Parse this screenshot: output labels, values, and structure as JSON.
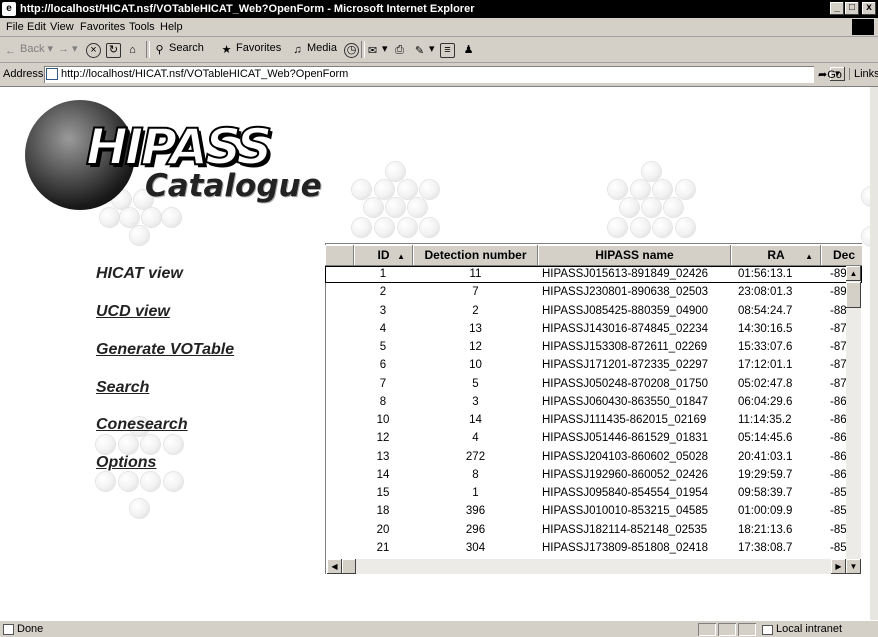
{
  "window": {
    "title": "http://localhost/HICAT.nsf/VOTableHICAT_Web?OpenForm - Microsoft Internet Explorer",
    "buttons": [
      "_",
      "ǩ",
      "x"
    ]
  },
  "menu": {
    "items": [
      "File",
      "Edit",
      "View",
      "Favorites",
      "Tools",
      "Help"
    ]
  },
  "toolbar": {
    "back": "Back",
    "forward": "→",
    "search": "Search",
    "favorites": "Favorites",
    "media": "Media"
  },
  "address": {
    "label": "Address",
    "url": "http://localhost/HICAT.nsf/VOTableHICAT_Web?OpenForm",
    "go": "Go",
    "links": "Links"
  },
  "logo": {
    "title": "HIPASS",
    "subtitle": "Catalogue"
  },
  "nav": {
    "items": [
      "HICAT view",
      "UCD view",
      "Generate VOTable",
      "Search",
      "Conesearch",
      "Options"
    ]
  },
  "table": {
    "columns": [
      "ID",
      "Detection number",
      "HIPASS name",
      "RA",
      "Dec"
    ],
    "rows": [
      [
        "1",
        "11",
        "HIPASSJ015613-891849_02426",
        "01:56:13.1",
        "-89:"
      ],
      [
        "2",
        "7",
        "HIPASSJ230801-890638_02503",
        "23:08:01.3",
        "-89:"
      ],
      [
        "3",
        "2",
        "HIPASSJ085425-880359_04900",
        "08:54:24.7",
        "-88:"
      ],
      [
        "4",
        "13",
        "HIPASSJ143016-874845_02234",
        "14:30:16.5",
        "-87:"
      ],
      [
        "5",
        "12",
        "HIPASSJ153308-872611_02269",
        "15:33:07.6",
        "-87:"
      ],
      [
        "6",
        "10",
        "HIPASSJ171201-872335_02297",
        "17:12:01.1",
        "-87:"
      ],
      [
        "7",
        "5",
        "HIPASSJ050248-870208_01750",
        "05:02:47.8",
        "-87:"
      ],
      [
        "8",
        "3",
        "HIPASSJ060430-863550_01847",
        "06:04:29.6",
        "-86:"
      ],
      [
        "10",
        "14",
        "HIPASSJ111435-862015_02169",
        "11:14:35.2",
        "-86:"
      ],
      [
        "12",
        "4",
        "HIPASSJ051446-861529_01831",
        "05:14:45.6",
        "-86:"
      ],
      [
        "13",
        "272",
        "HIPASSJ204103-860602_05028",
        "20:41:03.1",
        "-86:"
      ],
      [
        "14",
        "8",
        "HIPASSJ192960-860052_02426",
        "19:29:59.7",
        "-86:"
      ],
      [
        "15",
        "1",
        "HIPASSJ095840-854554_01954",
        "09:58:39.7",
        "-85:"
      ],
      [
        "18",
        "396",
        "HIPASSJ010010-853215_04585",
        "01:00:09.9",
        "-85:"
      ],
      [
        "20",
        "296",
        "HIPASSJ182114-852148_02535",
        "18:21:13.6",
        "-85:"
      ],
      [
        "21",
        "304",
        "HIPASSJ173809-851808_02418",
        "17:38:08.7",
        "-85:"
      ]
    ]
  },
  "status": {
    "text": "Done",
    "zone": "Local intranet"
  }
}
